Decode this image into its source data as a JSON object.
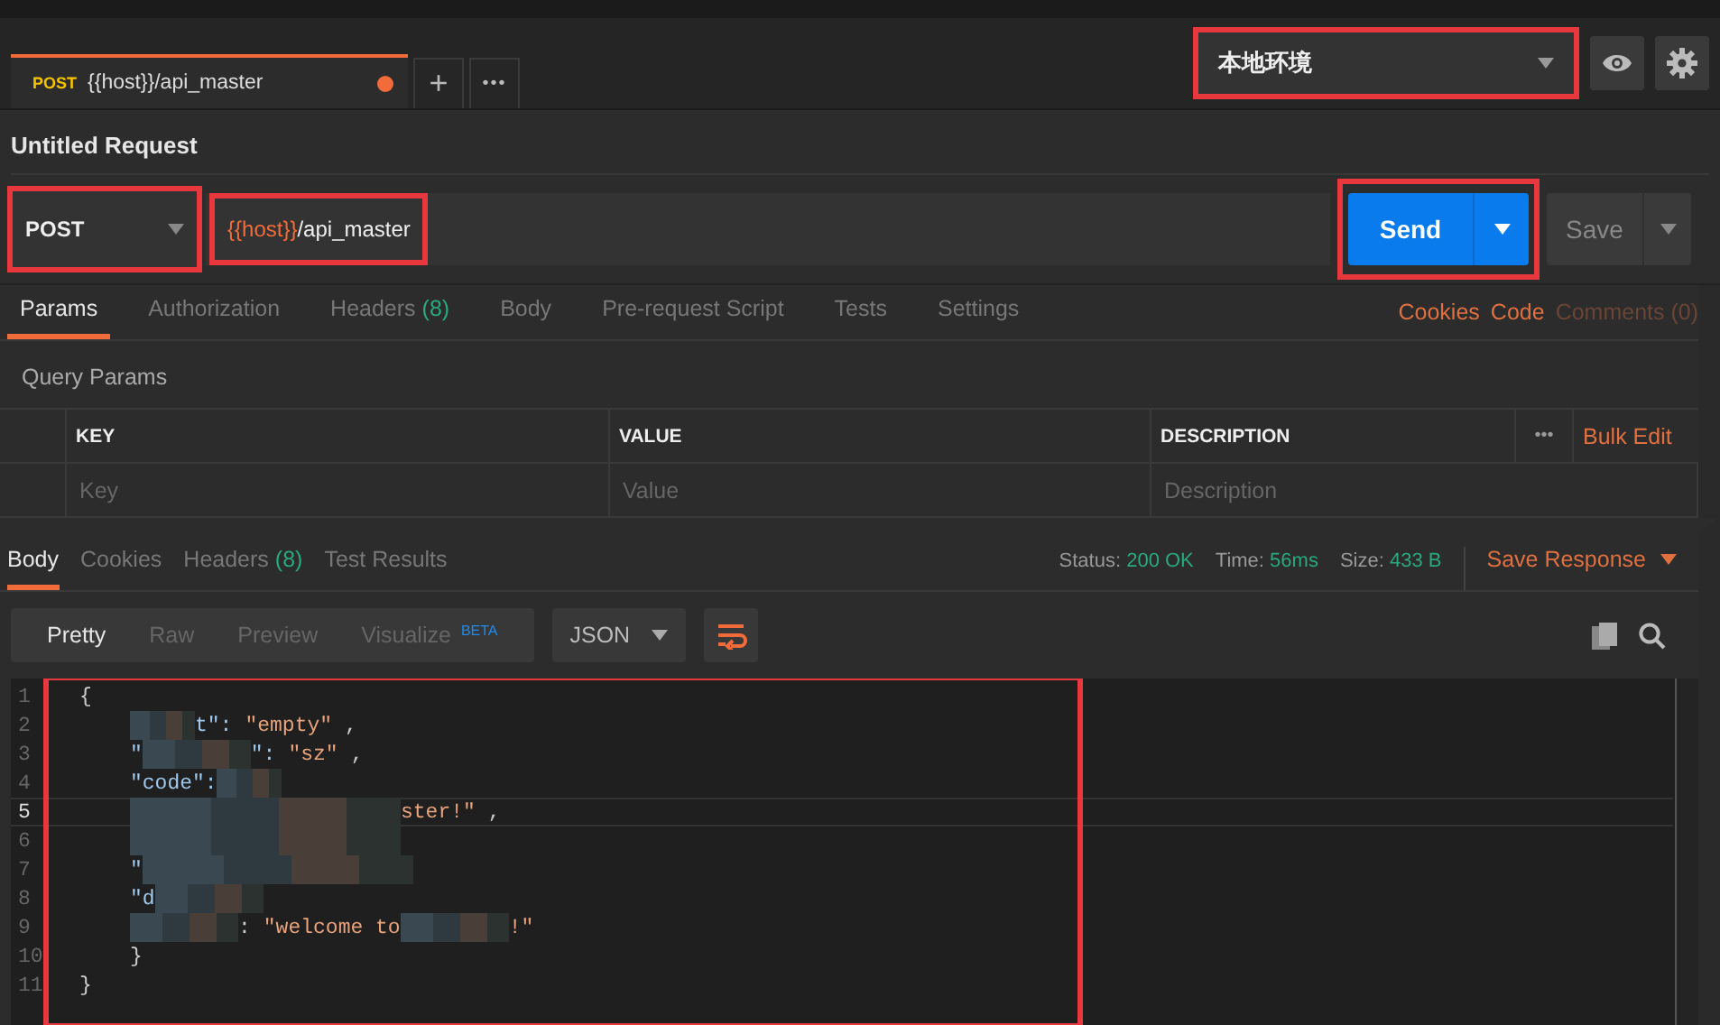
{
  "tab_bar": {
    "tabs": [
      {
        "method": "POST",
        "title": "{{host}}/api_master",
        "unsaved": true,
        "selected": true
      }
    ],
    "new_tab": "+",
    "more": "•••"
  },
  "environment": {
    "value": "本地环境",
    "highlighted": true
  },
  "request": {
    "title": "Untitled Request",
    "method": {
      "value": "POST",
      "highlighted": true
    },
    "url": {
      "variable": "{{host}}",
      "path": "/api_master",
      "highlighted": true
    },
    "send": {
      "label": "Send",
      "highlighted": true
    },
    "save": {
      "label": "Save"
    }
  },
  "request_tabs": [
    {
      "label": "Params",
      "selected": true
    },
    {
      "label": "Authorization",
      "selected": false
    },
    {
      "label": "Headers",
      "count": "(8)",
      "selected": false
    },
    {
      "label": "Body",
      "selected": false
    },
    {
      "label": "Pre-request Script",
      "selected": false
    },
    {
      "label": "Tests",
      "selected": false
    },
    {
      "label": "Settings",
      "selected": false
    }
  ],
  "request_links": [
    {
      "label": "Cookies",
      "enabled": true
    },
    {
      "label": "Code",
      "enabled": true
    },
    {
      "label": "Comments (0)",
      "enabled": false
    }
  ],
  "query_params": {
    "title": "Query Params",
    "columns": [
      "KEY",
      "VALUE",
      "DESCRIPTION"
    ],
    "more": "•••",
    "bulk_edit": "Bulk Edit",
    "placeholders": [
      "Key",
      "Value",
      "Description"
    ]
  },
  "response_tabs": [
    {
      "label": "Body",
      "selected": true
    },
    {
      "label": "Cookies",
      "selected": false
    },
    {
      "label": "Headers",
      "count": "(8)",
      "selected": false
    },
    {
      "label": "Test Results",
      "selected": false
    }
  ],
  "status": [
    {
      "label": "Status:",
      "value": "200 OK"
    },
    {
      "label": "Time:",
      "value": "56ms"
    },
    {
      "label": "Size:",
      "value": "433 B"
    }
  ],
  "save_response": "Save Response",
  "view_modes": [
    {
      "label": "Pretty",
      "selected": true
    },
    {
      "label": "Raw",
      "selected": false
    },
    {
      "label": "Preview",
      "selected": false
    },
    {
      "label": "Visualize",
      "badge": "BETA",
      "selected": false
    }
  ],
  "format": "JSON",
  "response_body": {
    "highlighted": true,
    "lines": [
      {
        "number": "1",
        "current": false,
        "indented": false,
        "parts": [
          {
            "kind": "punct",
            "text": "{"
          }
        ]
      },
      {
        "number": "2",
        "current": false,
        "indented": true,
        "parts": [
          {
            "kind": "redacted_short"
          },
          {
            "kind": "key",
            "text": "t\":"
          },
          {
            "kind": "string",
            "text": "\"empty\""
          },
          {
            "kind": "punct",
            "text": ","
          }
        ]
      },
      {
        "number": "3",
        "current": false,
        "indented": true,
        "parts": [
          {
            "kind": "key",
            "text": "\""
          },
          {
            "kind": "redacted_medium"
          },
          {
            "kind": "key",
            "text": "\":"
          },
          {
            "kind": "string",
            "text": "\"sz\""
          },
          {
            "kind": "punct",
            "text": ","
          }
        ]
      },
      {
        "number": "4",
        "current": false,
        "indented": true,
        "parts": [
          {
            "kind": "key",
            "text": "\"code\":"
          },
          {
            "kind": "redacted_short"
          }
        ]
      },
      {
        "number": "5",
        "current": true,
        "indented": true,
        "parts": [
          {
            "kind": "redacted_long"
          },
          {
            "kind": "string",
            "text": "ster!\""
          },
          {
            "kind": "punct",
            "text": ","
          }
        ]
      },
      {
        "number": "6",
        "current": false,
        "indented": true,
        "parts": [
          {
            "kind": "redacted_long"
          }
        ]
      },
      {
        "number": "7",
        "current": false,
        "indented": true,
        "parts": [
          {
            "kind": "key",
            "text": "\""
          },
          {
            "kind": "redacted_long"
          }
        ]
      },
      {
        "number": "8",
        "current": false,
        "indented": true,
        "parts": [
          {
            "kind": "key",
            "text": "\"d"
          },
          {
            "kind": "redacted_medium"
          }
        ]
      },
      {
        "number": "9",
        "current": false,
        "indented": true,
        "parts": [
          {
            "kind": "redacted_medium"
          },
          {
            "kind": "punct",
            "text": ":"
          },
          {
            "kind": "string",
            "text": "\"welcome to"
          },
          {
            "kind": "redacted_medium"
          },
          {
            "kind": "string",
            "text": "!\""
          }
        ]
      },
      {
        "number": "10",
        "current": false,
        "indented": true,
        "parts": [
          {
            "kind": "punct",
            "text": "}"
          }
        ]
      },
      {
        "number": "11",
        "current": false,
        "indented": false,
        "parts": [
          {
            "kind": "punct",
            "text": "}"
          }
        ]
      }
    ]
  }
}
